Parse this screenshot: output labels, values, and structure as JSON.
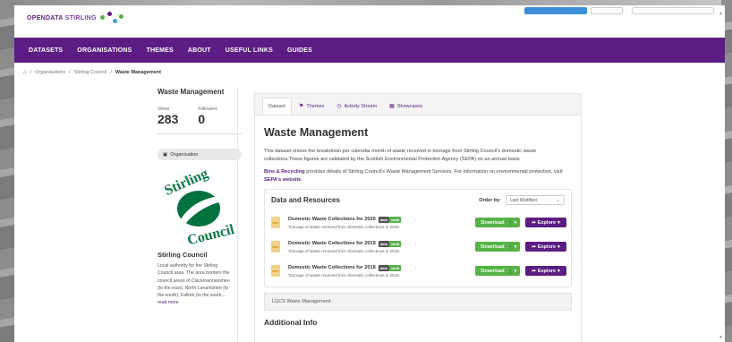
{
  "brand": {
    "logo_a": "OPENDATA",
    "logo_b": "STIRLING"
  },
  "nav": [
    "DATASETS",
    "ORGANISATIONS",
    "THEMES",
    "ABOUT",
    "USEFUL LINKS",
    "GUIDES"
  ],
  "breadcrumb": {
    "home_icon": "home-icon",
    "items": [
      "Organisations",
      "Stirling Council",
      "Waste Management"
    ],
    "sep": "/"
  },
  "sidebar": {
    "title": "Waste Management",
    "views_label": "Views",
    "views": "283",
    "followers_label": "Followers",
    "followers": "0",
    "org_chip": "Organisation",
    "logo_word1": "Stirling",
    "logo_word2": "Council",
    "org_name": "Stirling Council",
    "org_desc": "Local authority for the Stirling Council area. The area borders the council areas of Clackmannanshire (to the east), North Lanarkshire (to the south), Falkirk (to the south...",
    "read_more": "read more"
  },
  "tabs": [
    {
      "label": "Dataset",
      "icon": ""
    },
    {
      "label": "Themes",
      "icon": "tag-icon"
    },
    {
      "label": "Activity Stream",
      "icon": "clock-icon"
    },
    {
      "label": "Showcases",
      "icon": "image-icon"
    }
  ],
  "dataset": {
    "title": "Waste Management",
    "description": "This dataset shows the breakdown per calendar month of waste received in tonnage from Stirling Council's domestic waste collections.These figures are validated by the Scottish Environmental Protection Agency (SEPA) on an annual basis",
    "info_link1": "Bins & Recycling",
    "info_mid": " provides details of Stirling Council's Waste Management Services. For information on environmental protection, visit ",
    "info_link2": "SEPA's website",
    "info_end": "."
  },
  "resources": {
    "heading": "Data and Resources",
    "order_label": "Order by:",
    "order_value": "Last Modified",
    "items": [
      {
        "name": "Domestic Waste Collections for 2020",
        "badge1": "data",
        "badge2": "valid",
        "sub": "Tonnage of waste received from domestic collections in 2020.",
        "download": "Download",
        "explore": "Explore"
      },
      {
        "name": "Domestic Waste Collections for 2019",
        "badge1": "data",
        "badge2": "valid",
        "sub": "Tonnage of waste received from domestic collections in 2019.",
        "download": "Download",
        "explore": "Explore"
      },
      {
        "name": "Domestic Waste Collections for 2018",
        "badge1": "data",
        "badge2": "valid",
        "sub": "Tonnage of waste received from domestic collections in 2018.",
        "download": "Download",
        "explore": "Explore"
      }
    ]
  },
  "lgcs": "LGCS Waste Management",
  "additional_info": "Additional Info",
  "colors": {
    "purple": "#5b1d83",
    "green": "#55b347"
  }
}
